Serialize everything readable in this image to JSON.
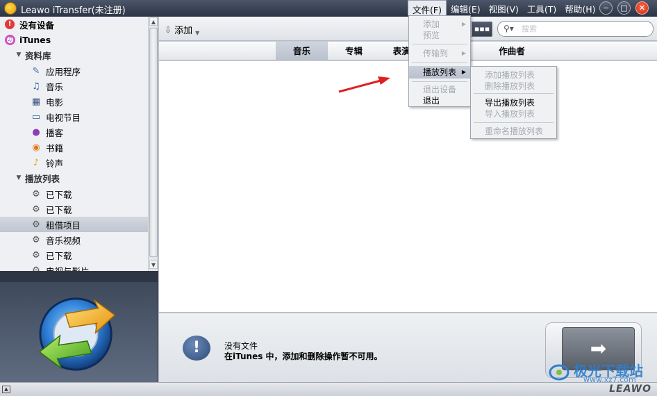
{
  "window": {
    "title": "Leawo iTransfer(未注册)",
    "menu": [
      "文件(F)",
      "编辑(E)",
      "视图(V)",
      "工具(T)",
      "帮助(H)"
    ],
    "controls": {
      "minimize": "−",
      "maximize": "□",
      "close": "✕"
    }
  },
  "sidebar": {
    "device": "没有设备",
    "itunes": "iTunes",
    "library_group": "资料库",
    "library_items": [
      "应用程序",
      "音乐",
      "电影",
      "电视节目",
      "播客",
      "书籍",
      "铃声"
    ],
    "playlist_group": "播放列表",
    "playlist_items": [
      "已下载",
      "已下载",
      "租借项目",
      "音乐视频",
      "已下载",
      "电视与影片"
    ],
    "selected": "租借项目"
  },
  "toolbar": {
    "add_label": "添加",
    "search_placeholder": "搜索"
  },
  "columns": [
    "音乐",
    "专辑",
    "表演者",
    "作曲者"
  ],
  "file_menu": {
    "items": [
      {
        "label": "添加",
        "disabled": true,
        "submenu": true
      },
      {
        "label": "预览",
        "disabled": true
      },
      {
        "label": "传输到",
        "disabled": true,
        "submenu": true
      },
      {
        "label": "播放列表",
        "disabled": false,
        "submenu": true,
        "highlight": true
      },
      {
        "label": "退出设备",
        "disabled": true
      },
      {
        "label": "退出",
        "disabled": false
      }
    ]
  },
  "playlist_submenu": {
    "items": [
      {
        "label": "添加播放列表",
        "disabled": true
      },
      {
        "label": "删除播放列表",
        "disabled": true
      },
      {
        "label": "导出播放列表",
        "disabled": false
      },
      {
        "label": "导入播放列表",
        "disabled": true
      },
      {
        "label": "重命名播放列表",
        "disabled": true
      }
    ]
  },
  "info": {
    "line1": "没有文件",
    "line2": "在iTunes 中，添加和删除操作暂不可用。"
  },
  "statusbar": {
    "brand": "LEAWO"
  },
  "watermark": {
    "text": "极光下载站",
    "url": "www.xz7.com"
  },
  "colors": {
    "titlebar": "#2b3444",
    "selection": "#bfc6d1",
    "close": "#c82a10"
  }
}
